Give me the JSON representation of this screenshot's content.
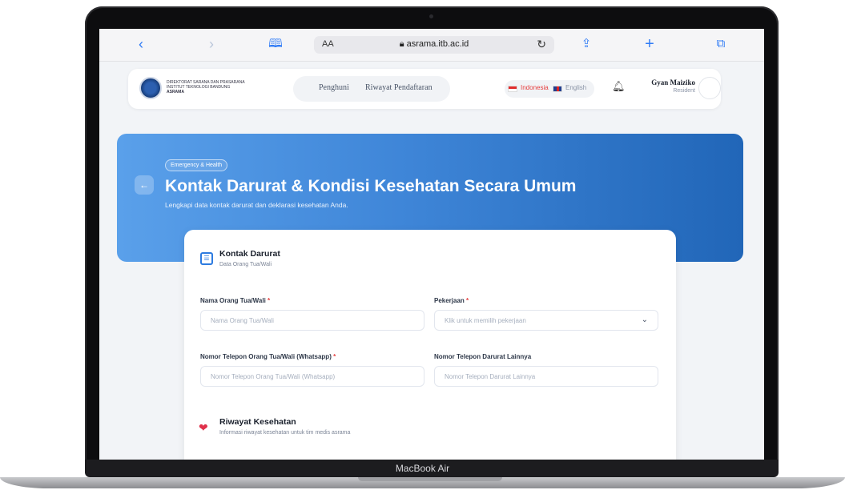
{
  "device": {
    "brand_label": "MacBook Air"
  },
  "browser": {
    "address_aa": "AA",
    "url": "asrama.itb.ac.id",
    "icons": [
      "chevron-left-icon",
      "chevron-right-icon",
      "book-icon",
      "reload-icon",
      "share-icon",
      "plus-icon",
      "tabs-icon"
    ]
  },
  "header": {
    "org_line1": "DIREKTORAT SARANA DAN PRASARANA",
    "org_line2": "INSTITUT TEKNOLOGI BANDUNG",
    "org_line3": "ASRAMA",
    "nav": [
      "Penghuni",
      "Riwayat Pendaftaran"
    ],
    "languages": [
      {
        "label": "Indonesia",
        "active": true,
        "color": "#e53e3e"
      },
      {
        "label": "English",
        "active": false,
        "color": "#8a94a6"
      }
    ],
    "user_name": "Gyan Maiziko",
    "user_role": "Resident"
  },
  "hero": {
    "badge": "Emergency & Health",
    "title": "Kontak Darurat & Kondisi Kesehatan Secara Umum",
    "subtitle": "Lengkapi data kontak darurat dan deklarasi kesehatan Anda."
  },
  "form": {
    "section1": {
      "title": "Kontak Darurat",
      "subtitle": "Data Orang Tua/Wali",
      "fields": [
        {
          "label": "Nama Orang Tua/Wali",
          "required": "*",
          "placeholder": "Nama Orang Tua/Wali"
        },
        {
          "label": "Pekerjaan",
          "required": "*",
          "placeholder": "Klik untuk memilih pekerjaan"
        },
        {
          "label": "Nomor Telepon Orang Tua/Wali (Whatsapp)",
          "required": "*",
          "placeholder": "Nomor Telepon Orang Tua/Wali (Whatsapp)"
        },
        {
          "label": "Nomor Telepon Darurat Lainnya",
          "required": "",
          "placeholder": "Nomor Telepon Darurat Lainnya"
        }
      ]
    },
    "section2": {
      "title": "Riwayat Kesehatan",
      "subtitle": "Informasi riwayat kesehatan untuk tim medis asrama"
    }
  },
  "colors": {
    "accent": "#2d7be0",
    "hero_start": "#5aa0ea",
    "hero_end": "#2166b8",
    "required": "#e53e3e"
  }
}
